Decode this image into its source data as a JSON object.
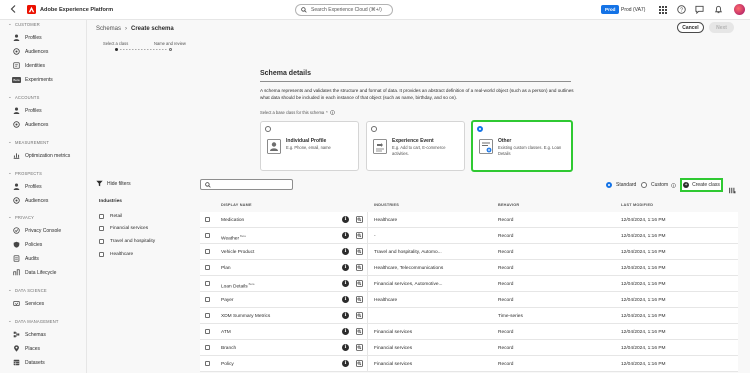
{
  "topbar": {
    "app_name": "Adobe Experience Platform",
    "search_placeholder": "Search Experience Cloud (⌘+/)",
    "env_badge": "Prod",
    "sandbox": "Prod (VA7)"
  },
  "sidebar": {
    "sections": [
      {
        "label": "CUSTOMER",
        "items": [
          "Profiles",
          "Audiences",
          "Identities",
          "Experiments"
        ]
      },
      {
        "label": "ACCOUNTS",
        "items": [
          "Profiles",
          "Audiences"
        ]
      },
      {
        "label": "MEASUREMENT",
        "items": [
          "Optimization metrics"
        ]
      },
      {
        "label": "PROSPECTS",
        "items": [
          "Profiles",
          "Audiences"
        ]
      },
      {
        "label": "PRIVACY",
        "items": [
          "Privacy Console",
          "Policies",
          "Audits",
          "Data Lifecycle"
        ]
      },
      {
        "label": "DATA SCIENCE",
        "items": [
          "Services"
        ]
      },
      {
        "label": "DATA MANAGEMENT",
        "items": [
          "Schemas",
          "Places",
          "Datasets"
        ]
      }
    ],
    "beta_badge": "Beta"
  },
  "breadcrumb": {
    "parent": "Schemas",
    "current": "Create schema"
  },
  "stepper": {
    "step1": "Select a class",
    "step2": "Name and review"
  },
  "actions": {
    "cancel": "Cancel",
    "next": "Next"
  },
  "schema_details": {
    "title": "Schema details",
    "description": "A schema represents and validates the structure and format of data. It provides an abstract definition of a real-world object (such as a person) and outlines what data should be included in each instance of that object (such as name, birthday, and so on).",
    "choose_label": "Select a base class for this schema",
    "required_mark": "*",
    "cards": [
      {
        "title": "Individual Profile",
        "subtitle": "E.g. Phone, email, name",
        "selected": false
      },
      {
        "title": "Experience Event",
        "subtitle": "E.g. Add to cart, E-commerce activities.",
        "selected": false
      },
      {
        "title": "Other",
        "subtitle": "Existing custom classes. E.g. Loan Details",
        "selected": true
      }
    ]
  },
  "filters": {
    "toggle_label": "Hide filters",
    "heading": "Industries",
    "items": [
      "Retail",
      "Financial services",
      "Travel and hospitality",
      "Healthcare"
    ]
  },
  "toolbar": {
    "standard": "Standard",
    "custom": "Custom",
    "create_class": "Create class"
  },
  "table": {
    "headers": [
      "DISPLAY NAME",
      "INDUSTRIES",
      "BEHAVIOR",
      "LAST MODIFIED"
    ],
    "rows": [
      {
        "name": "Medication",
        "beta": "",
        "industries": "Healthcare",
        "behavior": "Record",
        "modified": "12/04/2024, 1:16 PM"
      },
      {
        "name": "Weather",
        "beta": "Beta",
        "industries": "-",
        "behavior": "Record",
        "modified": "12/04/2024, 1:16 PM"
      },
      {
        "name": "Vehicle Product",
        "beta": "",
        "industries": "Travel and hospitality, Automo...",
        "behavior": "Record",
        "modified": "12/04/2024, 1:16 PM"
      },
      {
        "name": "Plan",
        "beta": "",
        "industries": "Healthcare, Telecommunications",
        "behavior": "Record",
        "modified": "12/04/2024, 1:16 PM"
      },
      {
        "name": "Loan Details",
        "beta": "Beta",
        "industries": "Financial services, Automotive...",
        "behavior": "Record",
        "modified": "12/04/2024, 1:16 PM"
      },
      {
        "name": "Payer",
        "beta": "",
        "industries": "Healthcare",
        "behavior": "Record",
        "modified": "12/04/2024, 1:16 PM"
      },
      {
        "name": "XDM Summary Metrics",
        "beta": "",
        "industries": "",
        "behavior": "Time-series",
        "modified": "12/04/2024, 1:16 PM"
      },
      {
        "name": "ATM",
        "beta": "",
        "industries": "Financial services",
        "behavior": "Record",
        "modified": "12/04/2024, 1:16 PM"
      },
      {
        "name": "Branch",
        "beta": "",
        "industries": "Financial services",
        "behavior": "Record",
        "modified": "12/04/2024, 1:16 PM"
      },
      {
        "name": "Policy",
        "beta": "",
        "industries": "Financial services",
        "behavior": "Record",
        "modified": "12/04/2024, 1:16 PM"
      }
    ]
  },
  "colors": {
    "accent": "#1473e6",
    "highlight": "#2fc932",
    "brand": "#eb1000"
  }
}
